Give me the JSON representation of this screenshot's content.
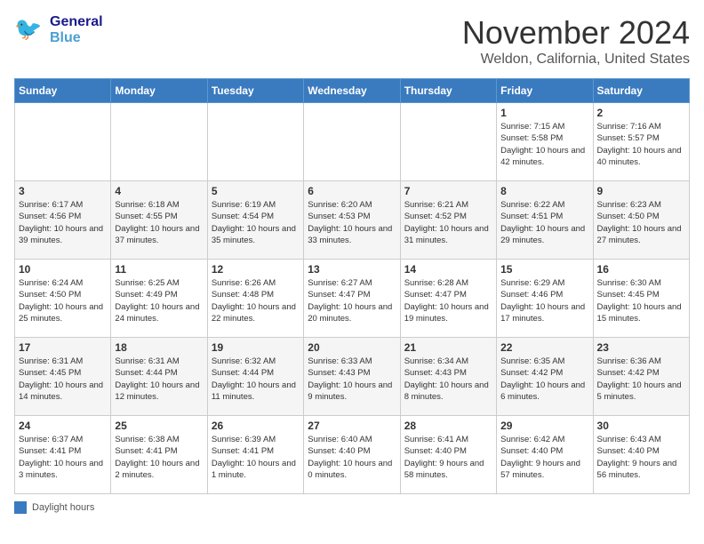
{
  "header": {
    "logo_line1": "General",
    "logo_line2": "Blue",
    "month": "November 2024",
    "location": "Weldon, California, United States"
  },
  "days_of_week": [
    "Sunday",
    "Monday",
    "Tuesday",
    "Wednesday",
    "Thursday",
    "Friday",
    "Saturday"
  ],
  "weeks": [
    [
      {
        "day": "",
        "info": ""
      },
      {
        "day": "",
        "info": ""
      },
      {
        "day": "",
        "info": ""
      },
      {
        "day": "",
        "info": ""
      },
      {
        "day": "",
        "info": ""
      },
      {
        "day": "1",
        "info": "Sunrise: 7:15 AM\nSunset: 5:58 PM\nDaylight: 10 hours and 42 minutes."
      },
      {
        "day": "2",
        "info": "Sunrise: 7:16 AM\nSunset: 5:57 PM\nDaylight: 10 hours and 40 minutes."
      }
    ],
    [
      {
        "day": "3",
        "info": "Sunrise: 6:17 AM\nSunset: 4:56 PM\nDaylight: 10 hours and 39 minutes."
      },
      {
        "day": "4",
        "info": "Sunrise: 6:18 AM\nSunset: 4:55 PM\nDaylight: 10 hours and 37 minutes."
      },
      {
        "day": "5",
        "info": "Sunrise: 6:19 AM\nSunset: 4:54 PM\nDaylight: 10 hours and 35 minutes."
      },
      {
        "day": "6",
        "info": "Sunrise: 6:20 AM\nSunset: 4:53 PM\nDaylight: 10 hours and 33 minutes."
      },
      {
        "day": "7",
        "info": "Sunrise: 6:21 AM\nSunset: 4:52 PM\nDaylight: 10 hours and 31 minutes."
      },
      {
        "day": "8",
        "info": "Sunrise: 6:22 AM\nSunset: 4:51 PM\nDaylight: 10 hours and 29 minutes."
      },
      {
        "day": "9",
        "info": "Sunrise: 6:23 AM\nSunset: 4:50 PM\nDaylight: 10 hours and 27 minutes."
      }
    ],
    [
      {
        "day": "10",
        "info": "Sunrise: 6:24 AM\nSunset: 4:50 PM\nDaylight: 10 hours and 25 minutes."
      },
      {
        "day": "11",
        "info": "Sunrise: 6:25 AM\nSunset: 4:49 PM\nDaylight: 10 hours and 24 minutes."
      },
      {
        "day": "12",
        "info": "Sunrise: 6:26 AM\nSunset: 4:48 PM\nDaylight: 10 hours and 22 minutes."
      },
      {
        "day": "13",
        "info": "Sunrise: 6:27 AM\nSunset: 4:47 PM\nDaylight: 10 hours and 20 minutes."
      },
      {
        "day": "14",
        "info": "Sunrise: 6:28 AM\nSunset: 4:47 PM\nDaylight: 10 hours and 19 minutes."
      },
      {
        "day": "15",
        "info": "Sunrise: 6:29 AM\nSunset: 4:46 PM\nDaylight: 10 hours and 17 minutes."
      },
      {
        "day": "16",
        "info": "Sunrise: 6:30 AM\nSunset: 4:45 PM\nDaylight: 10 hours and 15 minutes."
      }
    ],
    [
      {
        "day": "17",
        "info": "Sunrise: 6:31 AM\nSunset: 4:45 PM\nDaylight: 10 hours and 14 minutes."
      },
      {
        "day": "18",
        "info": "Sunrise: 6:31 AM\nSunset: 4:44 PM\nDaylight: 10 hours and 12 minutes."
      },
      {
        "day": "19",
        "info": "Sunrise: 6:32 AM\nSunset: 4:44 PM\nDaylight: 10 hours and 11 minutes."
      },
      {
        "day": "20",
        "info": "Sunrise: 6:33 AM\nSunset: 4:43 PM\nDaylight: 10 hours and 9 minutes."
      },
      {
        "day": "21",
        "info": "Sunrise: 6:34 AM\nSunset: 4:43 PM\nDaylight: 10 hours and 8 minutes."
      },
      {
        "day": "22",
        "info": "Sunrise: 6:35 AM\nSunset: 4:42 PM\nDaylight: 10 hours and 6 minutes."
      },
      {
        "day": "23",
        "info": "Sunrise: 6:36 AM\nSunset: 4:42 PM\nDaylight: 10 hours and 5 minutes."
      }
    ],
    [
      {
        "day": "24",
        "info": "Sunrise: 6:37 AM\nSunset: 4:41 PM\nDaylight: 10 hours and 3 minutes."
      },
      {
        "day": "25",
        "info": "Sunrise: 6:38 AM\nSunset: 4:41 PM\nDaylight: 10 hours and 2 minutes."
      },
      {
        "day": "26",
        "info": "Sunrise: 6:39 AM\nSunset: 4:41 PM\nDaylight: 10 hours and 1 minute."
      },
      {
        "day": "27",
        "info": "Sunrise: 6:40 AM\nSunset: 4:40 PM\nDaylight: 10 hours and 0 minutes."
      },
      {
        "day": "28",
        "info": "Sunrise: 6:41 AM\nSunset: 4:40 PM\nDaylight: 9 hours and 58 minutes."
      },
      {
        "day": "29",
        "info": "Sunrise: 6:42 AM\nSunset: 4:40 PM\nDaylight: 9 hours and 57 minutes."
      },
      {
        "day": "30",
        "info": "Sunrise: 6:43 AM\nSunset: 4:40 PM\nDaylight: 9 hours and 56 minutes."
      }
    ]
  ],
  "legend": {
    "label": "Daylight hours"
  },
  "colors": {
    "header_bg": "#3a7abf",
    "accent": "#1a5a9a"
  }
}
